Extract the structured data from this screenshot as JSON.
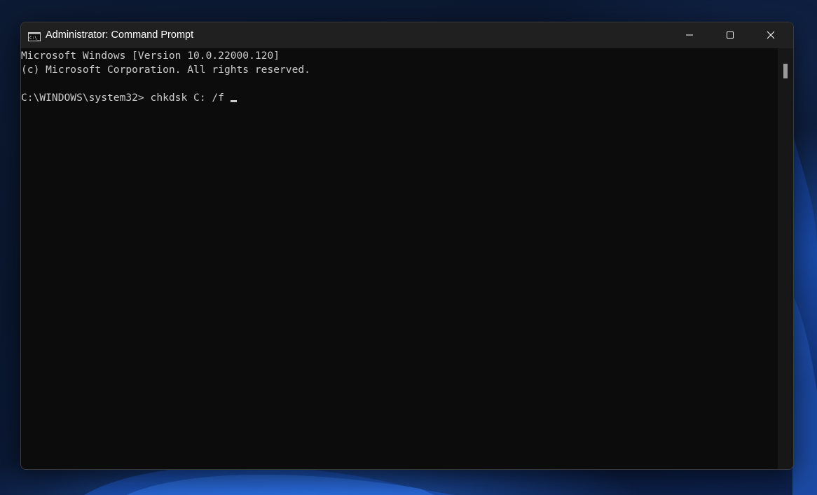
{
  "window": {
    "title": "Administrator: Command Prompt",
    "icon": "cmd-icon"
  },
  "caption_buttons": {
    "minimize_icon": "minimize-icon",
    "maximize_icon": "maximize-icon",
    "close_icon": "close-icon"
  },
  "console": {
    "lines": [
      "Microsoft Windows [Version 10.0.22000.120]",
      "(c) Microsoft Corporation. All rights reserved."
    ],
    "prompt": "C:\\WINDOWS\\system32>",
    "command": "chkdsk C: /f"
  },
  "colors": {
    "console_background": "#0c0c0c",
    "console_text": "#cccccc",
    "titlebar": "#202020"
  }
}
